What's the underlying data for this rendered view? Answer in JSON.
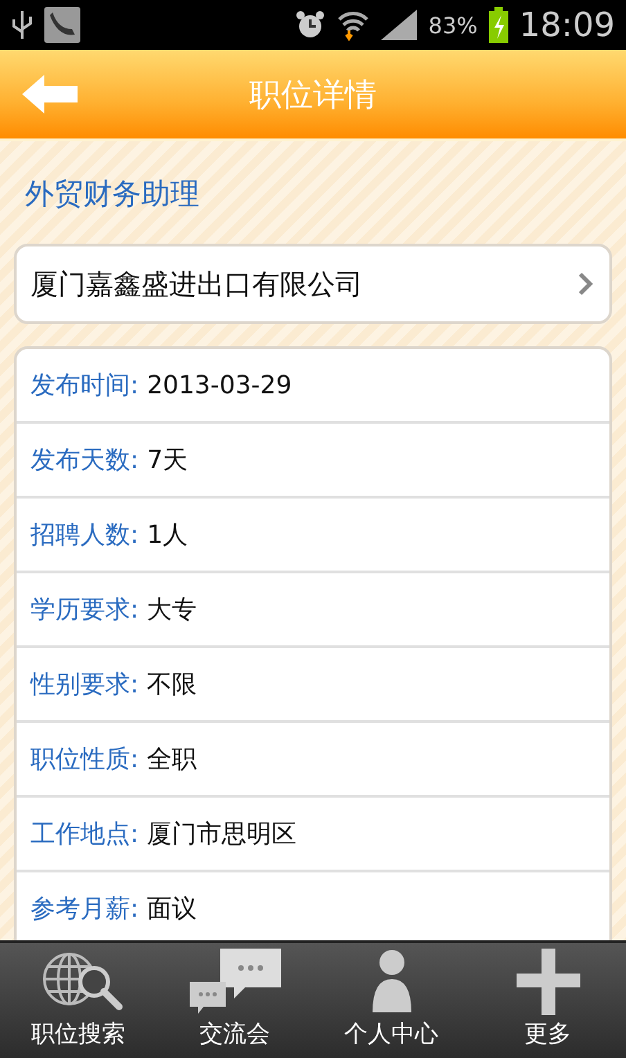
{
  "status_bar": {
    "battery_percent": "83%",
    "time": "18:09"
  },
  "header": {
    "title": "职位详情"
  },
  "job_title": "外贸财务助理",
  "company": {
    "name": "厦门嘉鑫盛进出口有限公司"
  },
  "details": [
    {
      "label": "发布时间:",
      "value": "2013-03-29"
    },
    {
      "label": "发布天数:",
      "value": "7天"
    },
    {
      "label": "招聘人数:",
      "value": "1人"
    },
    {
      "label": "学历要求:",
      "value": "大专"
    },
    {
      "label": "性别要求:",
      "value": "不限"
    },
    {
      "label": "职位性质:",
      "value": "全职"
    },
    {
      "label": "工作地点:",
      "value": "厦门市思明区"
    },
    {
      "label": "参考月薪:",
      "value": "面议"
    }
  ],
  "bottom_nav": [
    {
      "kind": "globe",
      "label": "职位搜索"
    },
    {
      "kind": "chat",
      "label": "交流会"
    },
    {
      "kind": "person",
      "label": "个人中心"
    },
    {
      "kind": "plus",
      "label": "更多"
    }
  ]
}
